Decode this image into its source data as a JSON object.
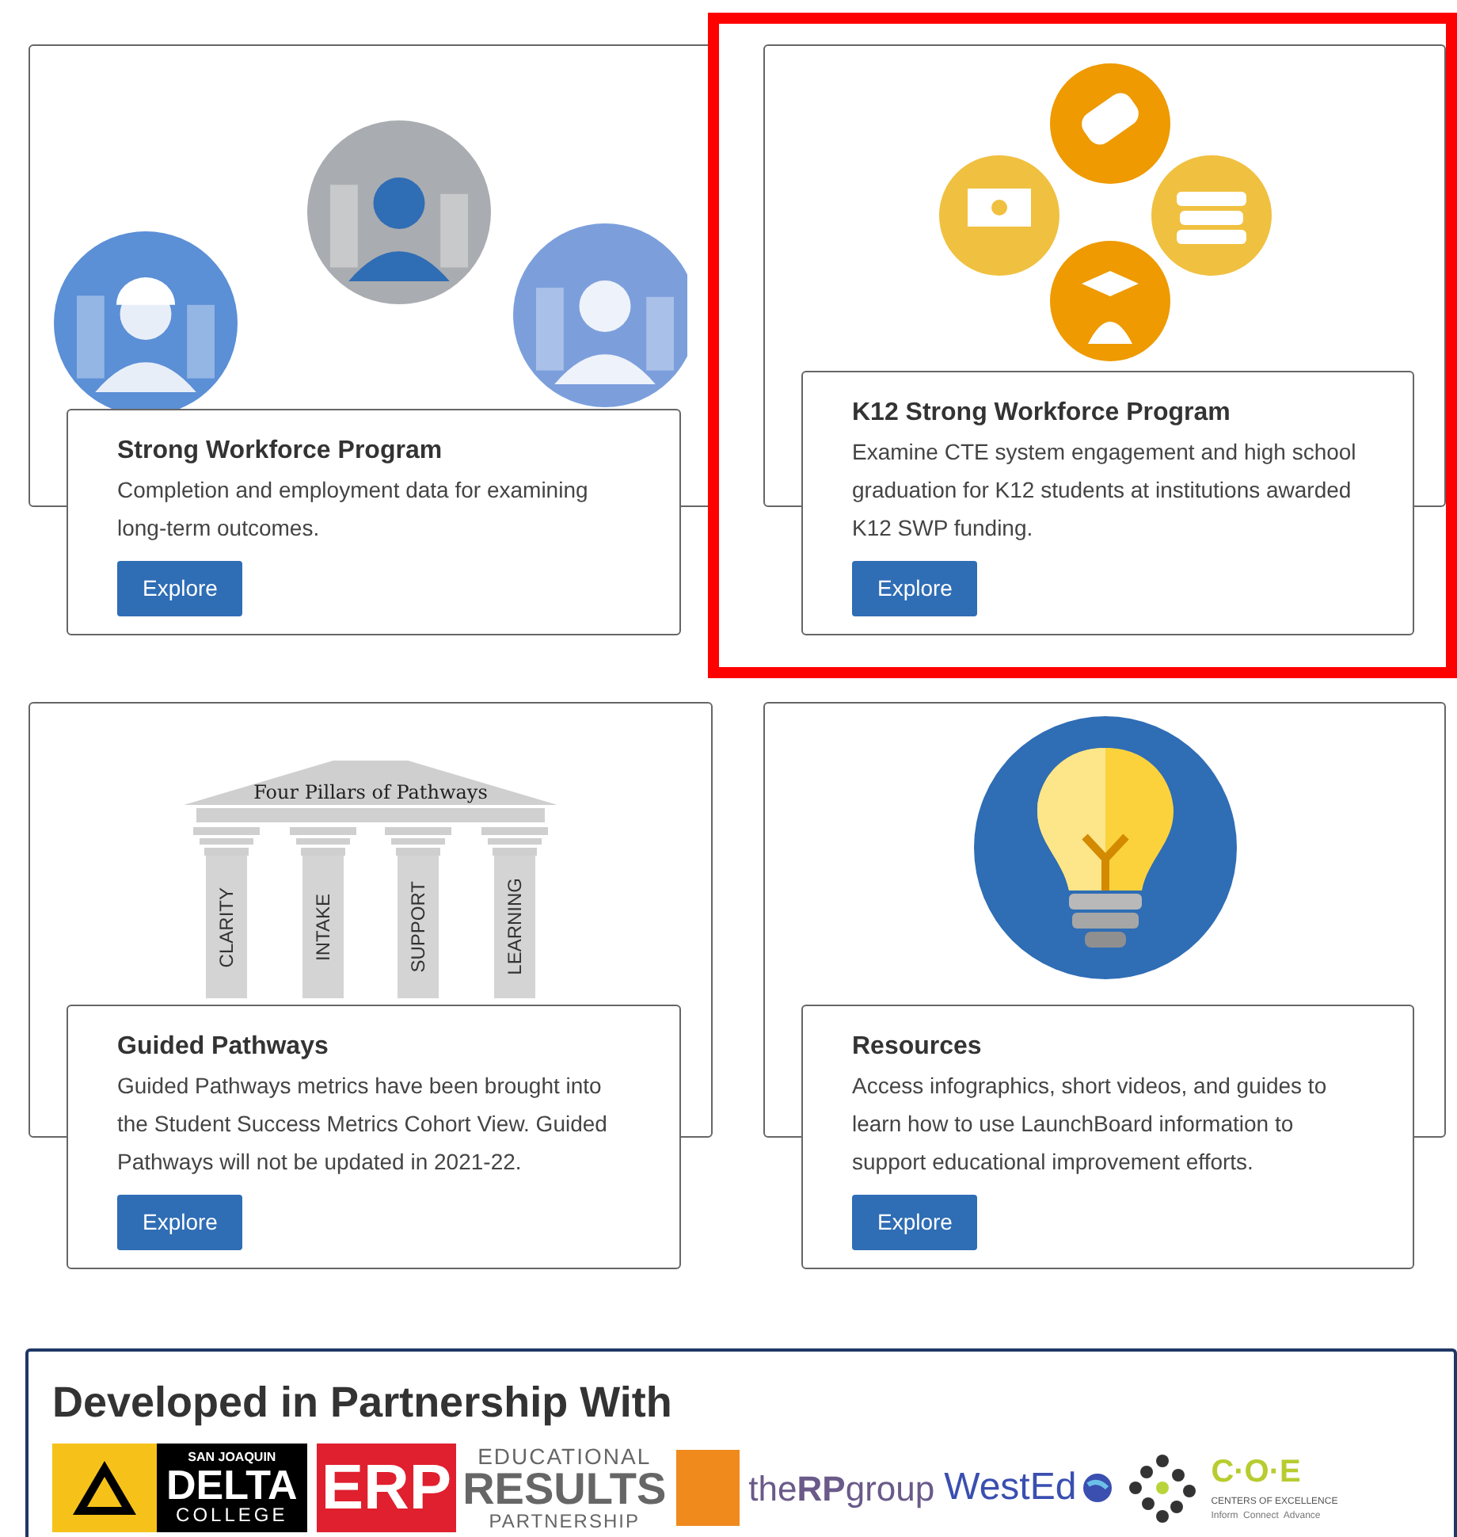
{
  "cards": [
    {
      "kind": "workers",
      "title": "Strong Workforce Program",
      "description": "Completion and employment data for examining long-term outcomes.",
      "button": "Explore",
      "highlighted": false
    },
    {
      "kind": "education",
      "title": "K12 Strong Workforce Program",
      "description": "Examine CTE system engagement and high school graduation for K12 students at institutions awarded K12 SWP funding.",
      "button": "Explore",
      "highlighted": true
    },
    {
      "kind": "pillars",
      "title": "Guided Pathways",
      "description": "Guided Pathways metrics have been brought into the Student Success Metrics Cohort View. Guided Pathways will not be updated in 2021-22.",
      "button": "Explore",
      "highlighted": false,
      "pillars": {
        "title": "Four Pillars of Pathways",
        "labels": [
          "CLARITY",
          "INTAKE",
          "SUPPORT",
          "LEARNING"
        ]
      }
    },
    {
      "kind": "bulb",
      "title": "Resources",
      "description": "Access infographics, short videos, and guides to learn how to use LaunchBoard information to support educational improvement efforts.",
      "button": "Explore",
      "highlighted": false
    }
  ],
  "partners": {
    "title": "Developed in Partnership With",
    "logos": [
      {
        "kind": "delta",
        "lines": [
          "SAN JOAQUIN",
          "DELTA",
          "COLLEGE"
        ]
      },
      {
        "kind": "erp",
        "lines": [
          "ERP",
          "EDUCATIONAL",
          "RESULTS",
          "PARTNERSHIP"
        ]
      },
      {
        "kind": "rp",
        "lines": [
          "the",
          "RP",
          "group"
        ]
      },
      {
        "kind": "wested",
        "lines": [
          "WestEd"
        ]
      },
      {
        "kind": "dots"
      },
      {
        "kind": "coe",
        "lines": [
          "C·O·E",
          "CENTERS OF EXCELLENCE",
          "Inform  Connect  Advance"
        ]
      }
    ]
  }
}
